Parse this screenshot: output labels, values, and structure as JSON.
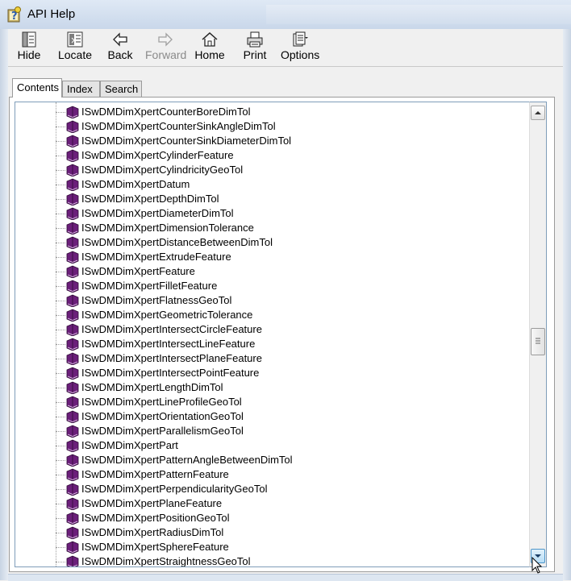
{
  "window": {
    "title": "API Help"
  },
  "toolbar": {
    "buttons": [
      {
        "label": "Hide",
        "icon": "hide-icon",
        "enabled": true
      },
      {
        "label": "Locate",
        "icon": "locate-icon",
        "enabled": true
      },
      {
        "label": "Back",
        "icon": "back-arrow-icon",
        "enabled": true
      },
      {
        "label": "Forward",
        "icon": "forward-arrow-icon",
        "enabled": false
      },
      {
        "label": "Home",
        "icon": "home-icon",
        "enabled": true
      },
      {
        "label": "Print",
        "icon": "printer-icon",
        "enabled": true
      },
      {
        "label": "Options",
        "icon": "options-icon",
        "enabled": true
      }
    ]
  },
  "tabs": [
    {
      "label": "Contents",
      "active": true
    },
    {
      "label": "Index",
      "active": false
    },
    {
      "label": "Search",
      "active": false
    }
  ],
  "tree": {
    "item_icon": "book-icon",
    "items": [
      "ISwDMDimXpertCounterBoreDimTol",
      "ISwDMDimXpertCounterSinkAngleDimTol",
      "ISwDMDimXpertCounterSinkDiameterDimTol",
      "ISwDMDimXpertCylinderFeature",
      "ISwDMDimXpertCylindricityGeoTol",
      "ISwDMDimXpertDatum",
      "ISwDMDimXpertDepthDimTol",
      "ISwDMDimXpertDiameterDimTol",
      "ISwDMDimXpertDimensionTolerance",
      "ISwDMDimXpertDistanceBetweenDimTol",
      "ISwDMDimXpertExtrudeFeature",
      "ISwDMDimXpertFeature",
      "ISwDMDimXpertFilletFeature",
      "ISwDMDimXpertFlatnessGeoTol",
      "ISwDMDimXpertGeometricTolerance",
      "ISwDMDimXpertIntersectCircleFeature",
      "ISwDMDimXpertIntersectLineFeature",
      "ISwDMDimXpertIntersectPlaneFeature",
      "ISwDMDimXpertIntersectPointFeature",
      "ISwDMDimXpertLengthDimTol",
      "ISwDMDimXpertLineProfileGeoTol",
      "ISwDMDimXpertOrientationGeoTol",
      "ISwDMDimXpertParallelismGeoTol",
      "ISwDMDimXpertPart",
      "ISwDMDimXpertPatternAngleBetweenDimTol",
      "ISwDMDimXpertPatternFeature",
      "ISwDMDimXpertPerpendicularityGeoTol",
      "ISwDMDimXpertPlaneFeature",
      "ISwDMDimXpertPositionGeoTol",
      "ISwDMDimXpertRadiusDimTol",
      "ISwDMDimXpertSphereFeature",
      "ISwDMDimXpertStraightnessGeoTol"
    ]
  },
  "colors": {
    "book": "#6b1f7a",
    "accent": "#3c7fc4"
  }
}
